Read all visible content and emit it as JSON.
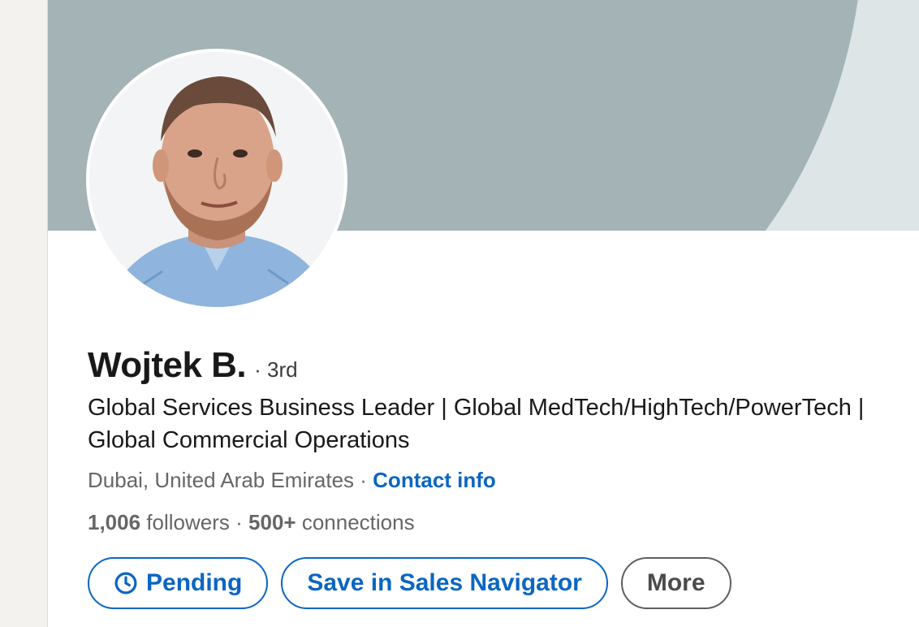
{
  "profile": {
    "name": "Wojtek B.",
    "degree": "· 3rd",
    "headline": "Global Services Business Leader | Global MedTech/HighTech/PowerTech | Global Commercial Operations",
    "location": "Dubai, United Arab Emirates",
    "separator": " · ",
    "contact_info_label": "Contact info",
    "followers_count": "1,006",
    "followers_label": "followers",
    "stats_separator": " · ",
    "connections_count": "500+",
    "connections_label": "connections"
  },
  "actions": {
    "pending_label": "Pending",
    "pending_icon": "clock-icon",
    "save_label": "Save in Sales Navigator",
    "more_label": "More"
  },
  "colors": {
    "accent": "#0a66c2",
    "banner_light": "#dde5e7",
    "banner_dark": "#a3b3b6",
    "text_primary": "#191919",
    "text_secondary": "#666666"
  }
}
